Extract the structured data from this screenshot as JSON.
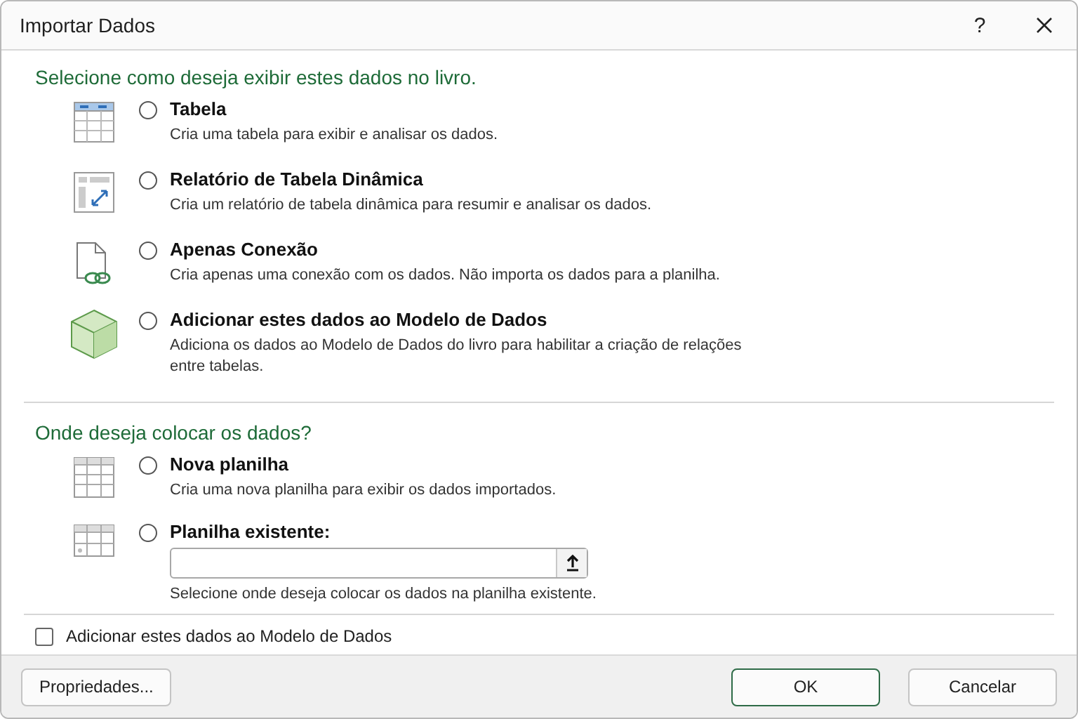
{
  "window": {
    "title": "Importar Dados",
    "help": "?"
  },
  "display_section": {
    "heading": "Selecione como deseja exibir estes dados no livro.",
    "options": [
      {
        "kind": "table",
        "label": "Tabela",
        "description": "Cria uma tabela para exibir e analisar os dados.",
        "selected": false
      },
      {
        "kind": "pivot",
        "label": "Relatório de Tabela Dinâmica",
        "description": "Cria um relatório de tabela dinâmica para resumir e analisar os dados.",
        "selected": false
      },
      {
        "kind": "connection",
        "label": "Apenas Conexão",
        "description": "Cria apenas uma conexão com os dados. Não importa os dados para a planilha.",
        "selected": false
      },
      {
        "kind": "cube",
        "label": "Adicionar estes dados ao Modelo de Dados",
        "description": "Adiciona os dados ao Modelo de Dados do livro para habilitar a criação de relações entre tabelas.",
        "selected": false
      }
    ]
  },
  "location_section": {
    "heading": "Onde deseja colocar os dados?",
    "options": [
      {
        "kind": "new_sheet",
        "label": "Nova planilha",
        "description": "Cria uma nova planilha para exibir os dados importados.",
        "selected": false
      },
      {
        "kind": "existing_sheet",
        "label": "Planilha existente:",
        "description": "Selecione onde deseja colocar os dados na planilha existente.",
        "selected": false,
        "has_field": true
      }
    ]
  },
  "add_to_model": {
    "label": "Adicionar estes dados ao Modelo de Dados",
    "checked": false
  },
  "buttons": {
    "left": [
      "Propriedades..."
    ],
    "right": [
      {
        "label": "OK",
        "default": true
      },
      {
        "label": "Cancelar",
        "default": false
      }
    ]
  }
}
